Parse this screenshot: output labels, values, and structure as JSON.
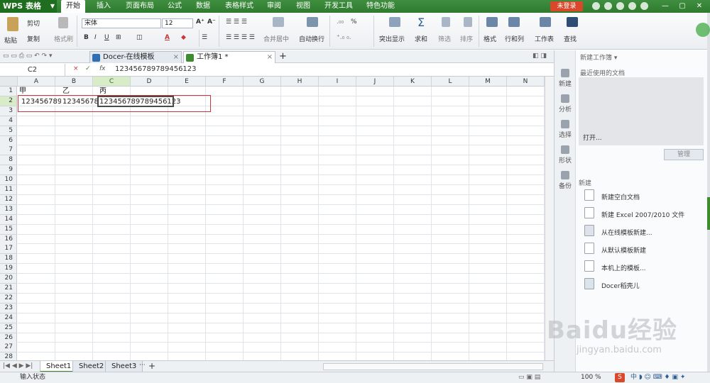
{
  "app": {
    "logo_label": "WPS 表格",
    "login_label": "未登录"
  },
  "menu_tabs": [
    "开始",
    "插入",
    "页面布局",
    "公式",
    "数据",
    "表格样式",
    "审阅",
    "视图",
    "开发工具",
    "特色功能"
  ],
  "ribbon": {
    "paste": "粘贴",
    "cut": "剪切",
    "copy": "复制",
    "format_painter": "格式刷",
    "font_name": "宋体",
    "font_size": "12",
    "bold": "B",
    "italic": "I",
    "underline": "U",
    "font_color": "A",
    "merge": "合并居中",
    "wrap": "自动换行",
    "percent": "%",
    "highlight": "突出显示",
    "sum": "求和",
    "filter": "筛选",
    "sort": "排序",
    "format": "格式",
    "rowcol": "行和列",
    "sheet": "工作表",
    "find": "查找"
  },
  "doc_tabs": [
    {
      "label": "Docer-在线模板",
      "close": "×"
    },
    {
      "label": "工作簿1 *",
      "close": "×"
    }
  ],
  "add_tab": "+",
  "formula_bar": {
    "namebox": "C2",
    "fx": "fx",
    "cancel": "×",
    "confirm": "✓",
    "content": "123456789789456123"
  },
  "columns": [
    "A",
    "B",
    "C",
    "D",
    "E",
    "F",
    "G",
    "H",
    "I",
    "J",
    "K",
    "L",
    "M",
    "N"
  ],
  "rows": [
    "1",
    "2",
    "3",
    "4",
    "5",
    "6",
    "7",
    "8",
    "9",
    "10",
    "11",
    "12",
    "13",
    "14",
    "15",
    "16",
    "17",
    "18",
    "19",
    "20",
    "21",
    "22",
    "23",
    "24",
    "25",
    "26",
    "27",
    "28"
  ],
  "cells": {
    "A1": "甲",
    "B1": "乙",
    "C1": "丙",
    "A2": "123456789",
    "B2": "123456789",
    "C2": "123456789789456123"
  },
  "sheets": [
    "Sheet1",
    "Sheet2",
    "Sheet3"
  ],
  "sheet_more": "···",
  "sheet_add": "+",
  "status": {
    "mode": "输入状态",
    "zoom": "100 %"
  },
  "side_tools": [
    "新建",
    "分析",
    "选择",
    "形状",
    "备份"
  ],
  "task_panel": {
    "title": "新建工作簿 ▾",
    "recent_title": "最近使用的文档",
    "open": "打开...",
    "manage": "管理",
    "new_section": "新建",
    "items": [
      "新建空白文档",
      "新建 Excel 2007/2010 文件",
      "从在线模板新建...",
      "从默认模板新建",
      "本机上的模板...",
      "Docer稻壳儿"
    ]
  },
  "watermark": {
    "brand": "Baidu经验",
    "url": "jingyan.baidu.com"
  },
  "colors": {
    "green": "#3d8c2f",
    "selection_red": "#c8373a",
    "login_red": "#d9482a"
  }
}
